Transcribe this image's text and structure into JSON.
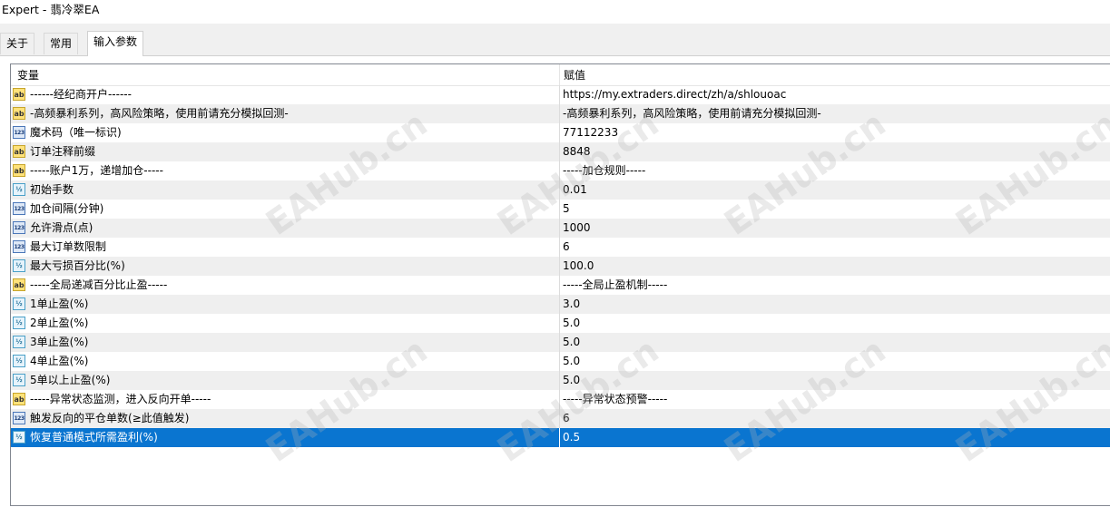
{
  "window": {
    "title": "Expert - 翡冷翠EA"
  },
  "tabs": [
    {
      "label": "关于"
    },
    {
      "label": "常用"
    },
    {
      "label": "输入参数"
    }
  ],
  "table": {
    "headers": {
      "variable": "变量",
      "value": "赋值"
    },
    "rows": [
      {
        "icon": "string-param-icon",
        "name": "------经纪商开户------",
        "value": "https://my.extraders.direct/zh/a/shlouoac"
      },
      {
        "icon": "string-param-icon",
        "name": "-高频暴利系列，高风险策略，使用前请充分模拟回测-",
        "value": "-高频暴利系列，高风险策略，使用前请充分模拟回测-"
      },
      {
        "icon": "integer-param-icon",
        "name": "魔术码（唯一标识)",
        "value": "77112233"
      },
      {
        "icon": "string-param-icon",
        "name": "订单注释前缀",
        "value": "8848"
      },
      {
        "icon": "string-param-icon",
        "name": "-----账户1万，递增加仓-----",
        "value": "-----加仓规则-----"
      },
      {
        "icon": "double-param-icon",
        "name": "初始手数",
        "value": "0.01"
      },
      {
        "icon": "integer-param-icon",
        "name": "加仓间隔(分钟)",
        "value": "5"
      },
      {
        "icon": "integer-param-icon",
        "name": "允许滑点(点)",
        "value": "1000"
      },
      {
        "icon": "integer-param-icon",
        "name": "最大订单数限制",
        "value": "6"
      },
      {
        "icon": "double-param-icon",
        "name": "最大亏损百分比(%)",
        "value": "100.0"
      },
      {
        "icon": "string-param-icon",
        "name": "-----全局递减百分比止盈-----",
        "value": "-----全局止盈机制-----"
      },
      {
        "icon": "double-param-icon",
        "name": "1单止盈(%)",
        "value": "3.0"
      },
      {
        "icon": "double-param-icon",
        "name": "2单止盈(%)",
        "value": "5.0"
      },
      {
        "icon": "double-param-icon",
        "name": "3单止盈(%)",
        "value": "5.0"
      },
      {
        "icon": "double-param-icon",
        "name": "4单止盈(%)",
        "value": "5.0"
      },
      {
        "icon": "double-param-icon",
        "name": "5单以上止盈(%)",
        "value": "5.0"
      },
      {
        "icon": "string-param-icon",
        "name": "-----异常状态监测，进入反向开单-----",
        "value": "-----异常状态预警-----"
      },
      {
        "icon": "integer-param-icon",
        "name": "触发反向的平仓单数(≥此值触发)",
        "value": "6"
      },
      {
        "icon": "double-param-icon",
        "name": "恢复普通模式所需盈利(%)",
        "value": "0.5",
        "selected": true
      }
    ]
  },
  "watermark": {
    "text": "EAHub.cn"
  },
  "colors": {
    "selection": "#0a75d0",
    "alt_row": "#efefef"
  }
}
